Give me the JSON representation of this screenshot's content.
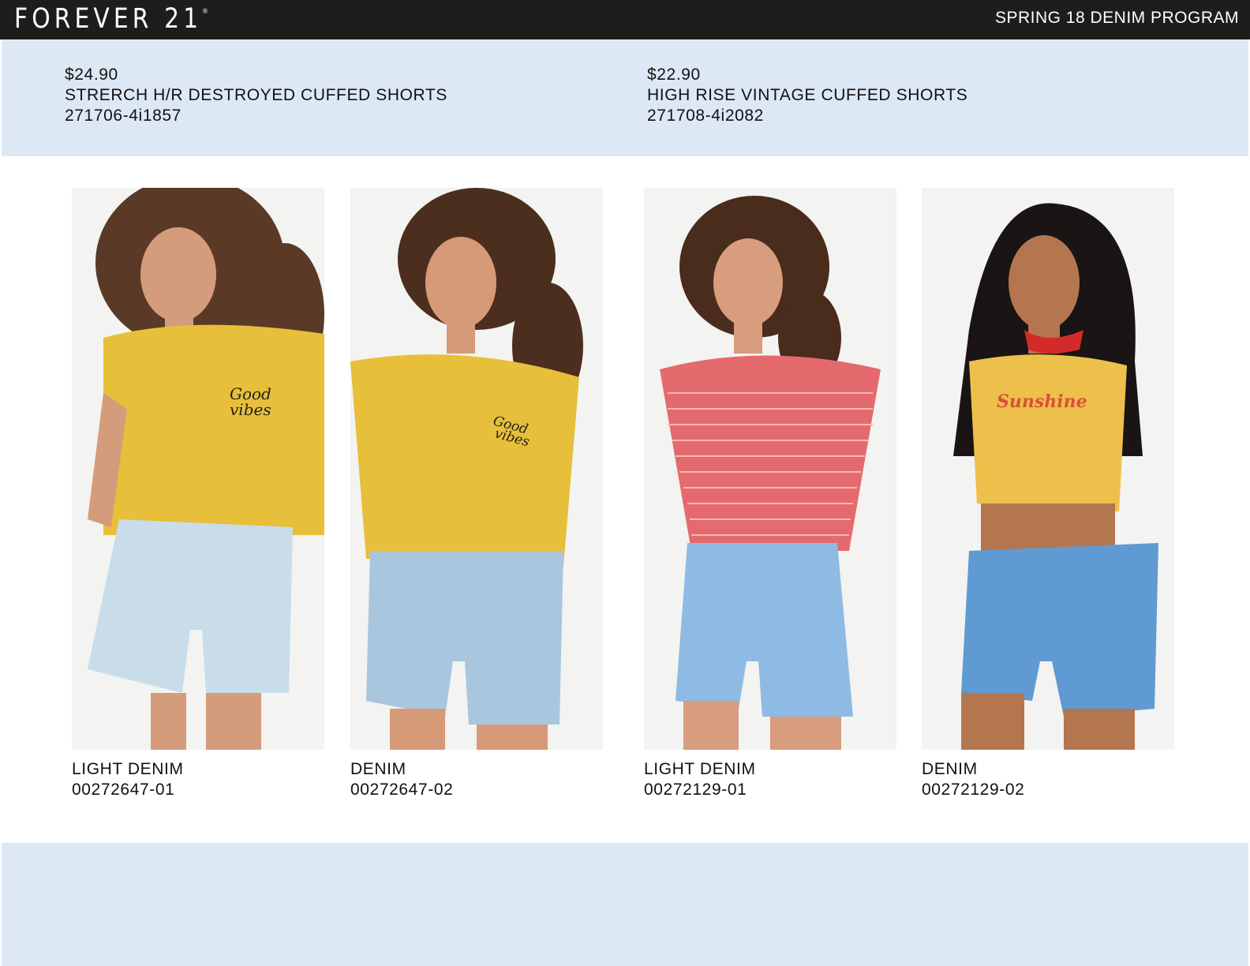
{
  "header": {
    "brand": "FOREVER 21",
    "brand_mark": "®",
    "program": "SPRING 18 DENIM PROGRAM"
  },
  "styles": [
    {
      "price": "$24.90",
      "name": "STRERCH H/R DESTROYED CUFFED SHORTS",
      "style_no": "271706-4i1857"
    },
    {
      "price": "$22.90",
      "name": "HIGH RISE VINTAGE CUFFED SHORTS",
      "style_no": "271708-4i2082"
    }
  ],
  "products": [
    {
      "color": "LIGHT DENIM",
      "sku": "00272647-01",
      "top_color": "#e8bf3a",
      "top_print": "Good vibes",
      "short_color": "#c9dcea"
    },
    {
      "color": "DENIM",
      "sku": "00272647-02",
      "top_color": "#e8bf3a",
      "top_print": "Good vibes",
      "short_color": "#a9c6df"
    },
    {
      "color": "LIGHT DENIM",
      "sku": "00272129-01",
      "top_color": "#e56a6d",
      "top_print": "",
      "short_color": "#8dbbe3"
    },
    {
      "color": "DENIM",
      "sku": "00272129-02",
      "top_color": "#ecc04a",
      "top_print": "Sunshine",
      "short_color": "#5f9ad2"
    }
  ]
}
